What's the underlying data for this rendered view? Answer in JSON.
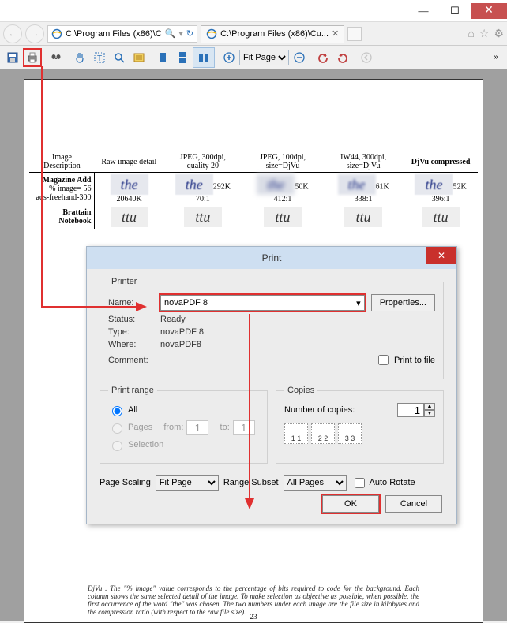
{
  "titlebar": {
    "minimize": "—",
    "maximize": "☐",
    "close": "✕"
  },
  "ie_nav": {
    "address": "C:\\Program Files (x86)\\C",
    "search_glyph": "🔍",
    "refresh_glyph": "↻",
    "tab_label": "C:\\Program Files (x86)\\Cu...",
    "tab_close": "✕"
  },
  "toolbar": {
    "zoom_value": "Fit Page",
    "overflow": "»"
  },
  "document": {
    "headers": [
      "Image Description",
      "Raw image detail",
      "JPEG, 300dpi, quality 20",
      "JPEG, 100dpi, size=DjVu",
      "IW44, 300dpi, size=DjVu",
      "DjVu compressed"
    ],
    "row1": {
      "head": "Magazine Add",
      "sub1": "% image= 56",
      "sub2": "ads-freehand-300",
      "cells": [
        "20640K",
        "292K 70:1",
        "50K 412:1",
        "61K 338:1",
        "52K 396:1"
      ],
      "sample": "the"
    },
    "row2": {
      "head": "Brattain Notebook",
      "sample": "ttu"
    },
    "footer": "DjVu . The \"% image\" value corresponds to the percentage of bits required to code for the background. Each column shows the same selected detail of the image. To make selection as objective as possible, when possible, the first occurrence of the word \"the\" was chosen. The two numbers under each image are the file size in kilobytes and the compression ratio (with respect to the raw file size).",
    "page_num": "23"
  },
  "print_dialog": {
    "title": "Print",
    "close": "✕",
    "printer": {
      "legend": "Printer",
      "name_lbl": "Name:",
      "name_val": "novaPDF 8",
      "properties": "Properties...",
      "status_lbl": "Status:",
      "status_val": "Ready",
      "type_lbl": "Type:",
      "type_val": "novaPDF 8",
      "where_lbl": "Where:",
      "where_val": "novaPDF8",
      "comment_lbl": "Comment:",
      "print_to_file": "Print to file"
    },
    "range": {
      "legend": "Print range",
      "all": "All",
      "pages": "Pages",
      "from_lbl": "from:",
      "from_val": "1",
      "to_lbl": "to:",
      "to_val": "1",
      "selection": "Selection"
    },
    "copies": {
      "legend": "Copies",
      "num_lbl": "Number of copies:",
      "num_val": "1",
      "c1": "1 1",
      "c2": "2 2",
      "c3": "3 3"
    },
    "scaling": {
      "page_scaling_lbl": "Page Scaling",
      "page_scaling_val": "Fit Page",
      "range_subset_lbl": "Range Subset",
      "range_subset_val": "All Pages",
      "auto_rotate": "Auto Rotate"
    },
    "ok": "OK",
    "cancel": "Cancel"
  }
}
